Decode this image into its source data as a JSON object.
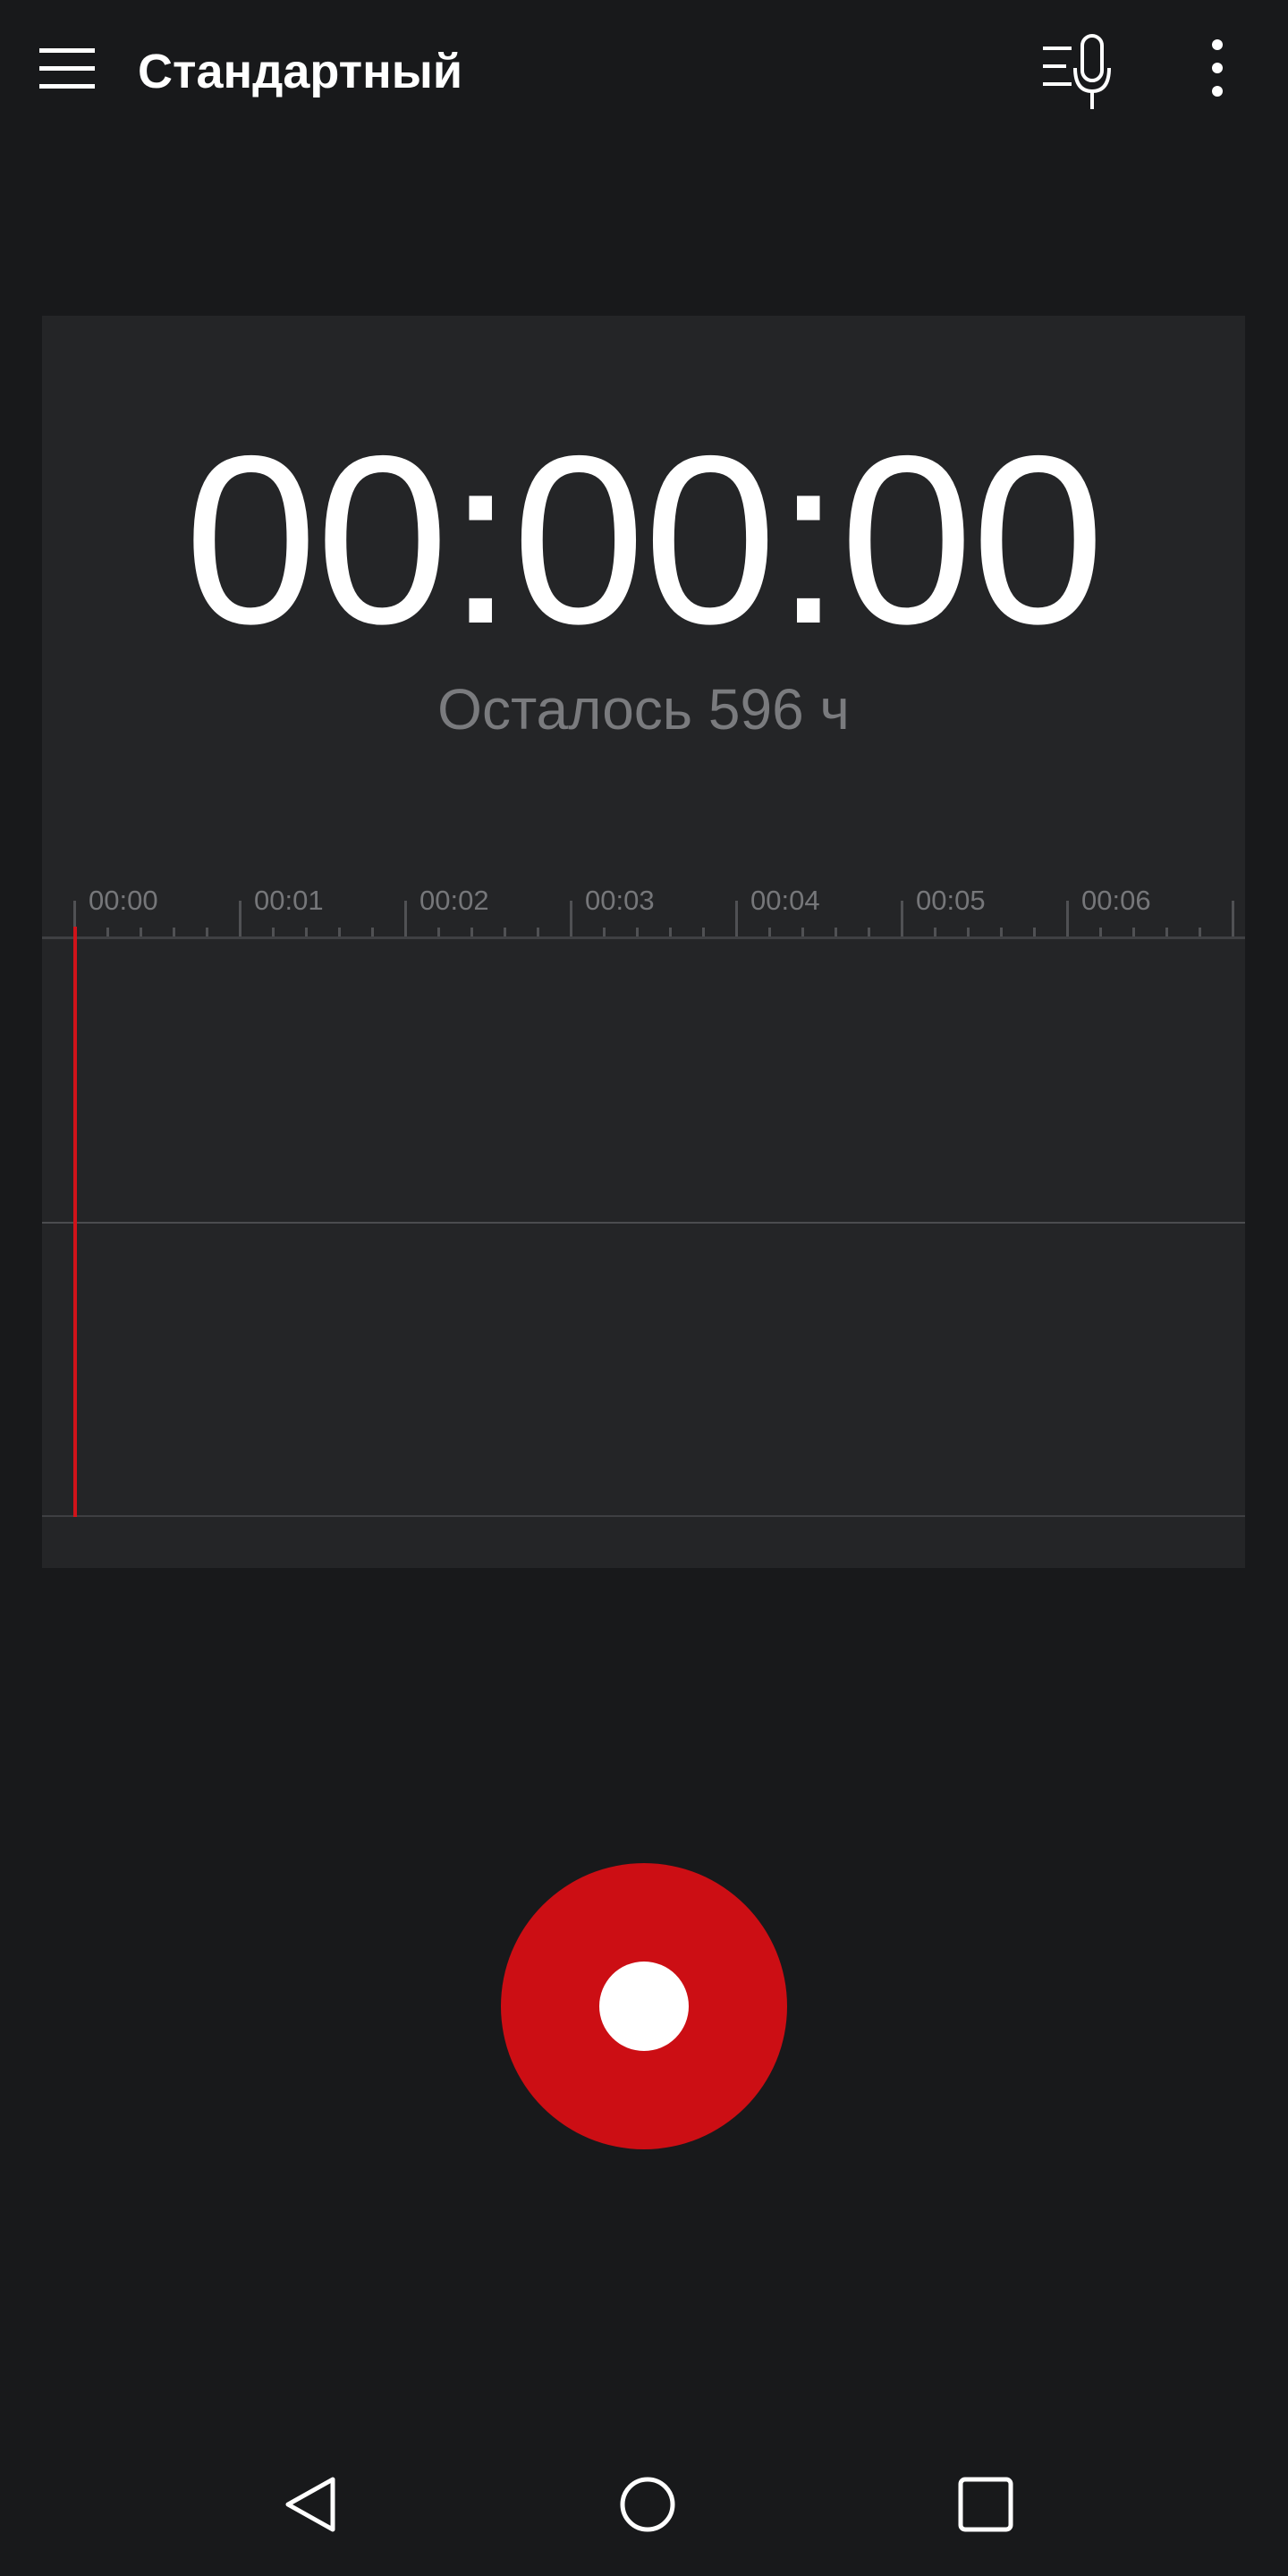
{
  "app": {
    "title": "Стандартный"
  },
  "toolbar": {
    "menu_icon": "hamburger-menu-icon",
    "mic_list_icon": "microphone-list-icon",
    "overflow_icon": "more-vertical-icon"
  },
  "recorder": {
    "elapsed": "00:00:00",
    "remaining": "Осталось 596 ч"
  },
  "timeline": {
    "labels": [
      "00:00",
      "00:01",
      "00:02",
      "00:03",
      "00:04",
      "00:05",
      "00:06"
    ]
  },
  "controls": {
    "record_icon": "record-icon"
  },
  "navigation": {
    "back_icon": "back-triangle-icon",
    "home_icon": "home-circle-icon",
    "recents_icon": "recents-square-icon"
  },
  "colors": {
    "background": "#18191b",
    "panel": "#242527",
    "accent_record": "#cc0e14",
    "playhead": "#d0131a",
    "secondary_text": "#7a7b7e"
  }
}
